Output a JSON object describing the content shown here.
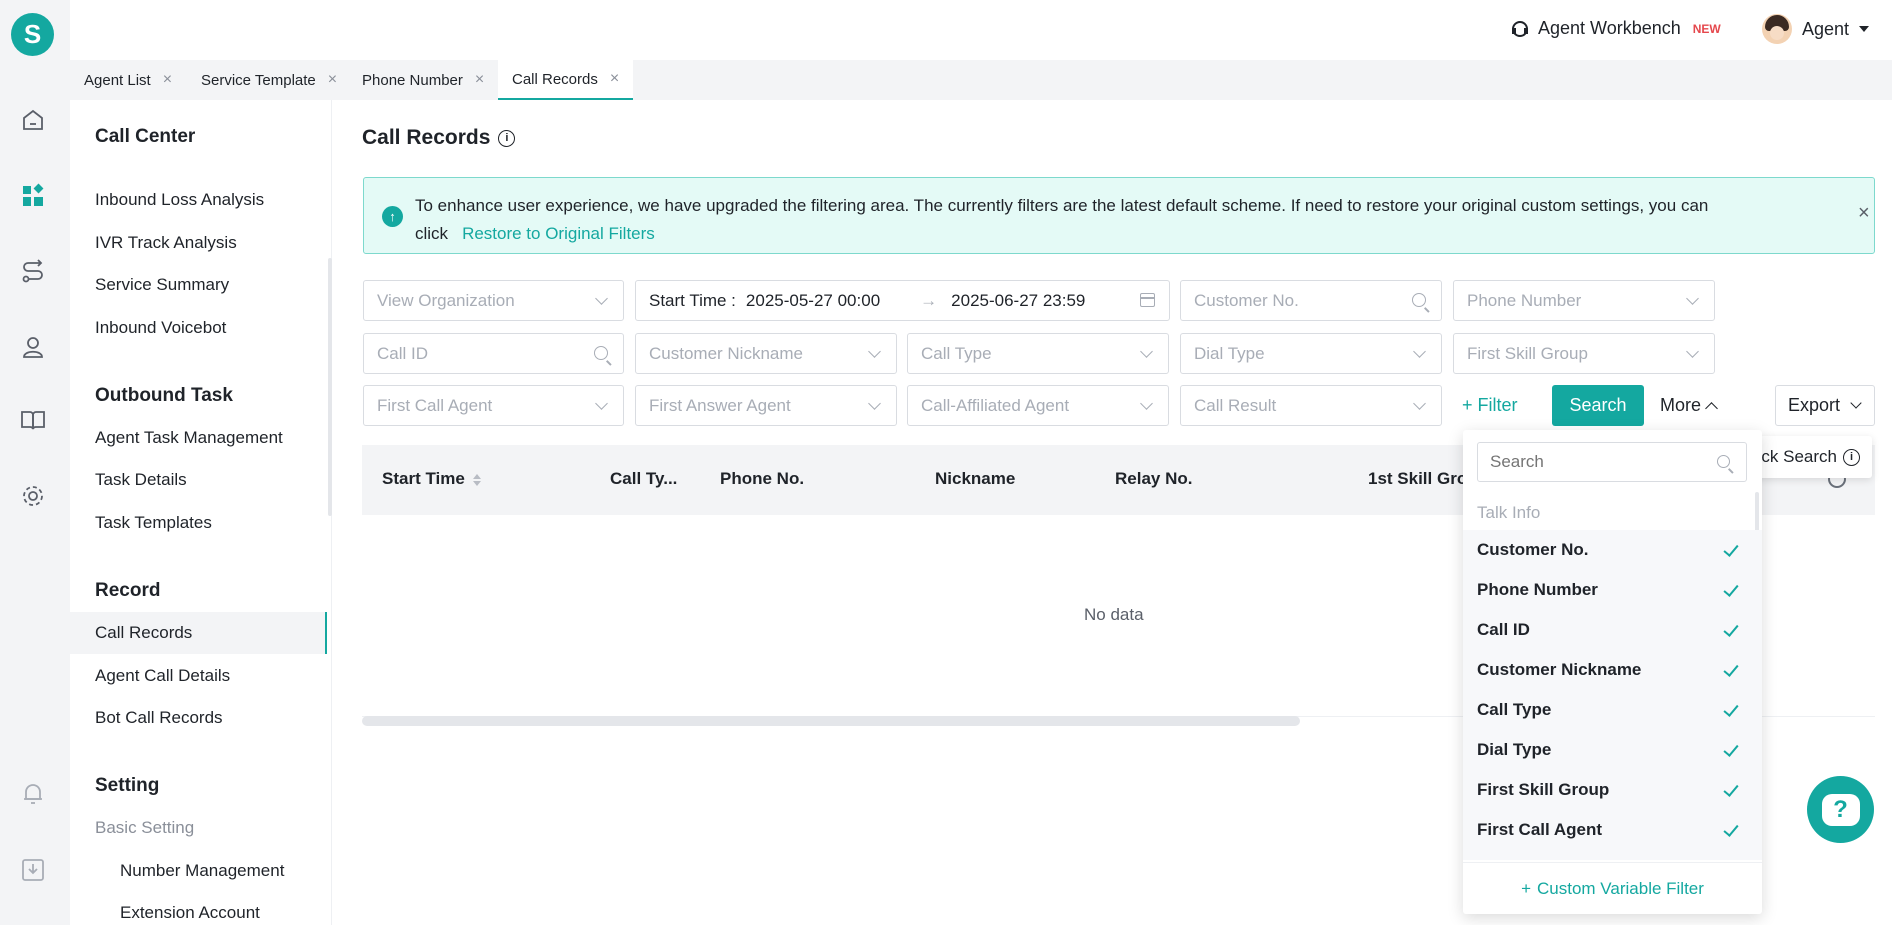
{
  "app": {
    "logo_letter": "S"
  },
  "header": {
    "workbench_label": "Agent Workbench",
    "new_badge": "NEW",
    "user_label": "Agent"
  },
  "tabs": [
    {
      "label": "Agent List"
    },
    {
      "label": "Service Template"
    },
    {
      "label": "Phone Number"
    },
    {
      "label": "Call Records"
    }
  ],
  "sidebar": {
    "sections": [
      {
        "title": "Call Center",
        "items": [
          "Inbound Loss Analysis",
          "IVR Track Analysis",
          "Service Summary",
          "Inbound Voicebot"
        ]
      },
      {
        "title": "Outbound Task",
        "items": [
          "Agent Task Management",
          "Task Details",
          "Task Templates"
        ]
      },
      {
        "title": "Record",
        "items": [
          "Call Records",
          "Agent Call Details",
          "Bot Call Records"
        ]
      },
      {
        "title": "Setting",
        "items": [
          "Basic Setting",
          "Number Management",
          "Extension Account"
        ]
      }
    ]
  },
  "page": {
    "title": "Call Records"
  },
  "notice": {
    "text": "To enhance user experience, we have upgraded the filtering area. The currently filters are the latest default scheme. If need to restore your original custom settings, you can click",
    "link": "Restore to Original Filters"
  },
  "filters": {
    "view_organization": "View Organization",
    "start_time_label": "Start Time :",
    "start_time_from": "2025-05-27 00:00",
    "start_time_to": "2025-06-27 23:59",
    "customer_no": "Customer No.",
    "phone_number": "Phone Number",
    "call_id": "Call ID",
    "customer_nickname": "Customer Nickname",
    "call_type": "Call Type",
    "dial_type": "Dial Type",
    "first_skill_group": "First Skill Group",
    "first_call_agent": "First Call Agent",
    "first_answer_agent": "First Answer Agent",
    "call_affiliated_agent": "Call-Affiliated Agent",
    "call_result": "Call Result"
  },
  "actions": {
    "filter": "Filter",
    "search": "Search",
    "more": "More",
    "export": "Export",
    "quick_search": "ck Search"
  },
  "table": {
    "columns": [
      "Start Time",
      "Call Ty...",
      "Phone No.",
      "Nickname",
      "Relay No.",
      "1st Skill Gro"
    ],
    "empty_text": "No data"
  },
  "dropdown": {
    "search_placeholder": "Search",
    "group_label": "Talk Info",
    "items": [
      {
        "label": "Customer No.",
        "checked": true
      },
      {
        "label": "Phone Number",
        "checked": true
      },
      {
        "label": "Call ID",
        "checked": true
      },
      {
        "label": "Customer Nickname",
        "checked": true
      },
      {
        "label": "Call Type",
        "checked": true
      },
      {
        "label": "Dial Type",
        "checked": true
      },
      {
        "label": "First Skill Group",
        "checked": true
      },
      {
        "label": "First Call Agent",
        "checked": true
      }
    ],
    "footer_label": "Custom Variable Filter"
  },
  "colors": {
    "accent": "#14a8a0",
    "notice_bg": "#e4faf6"
  }
}
